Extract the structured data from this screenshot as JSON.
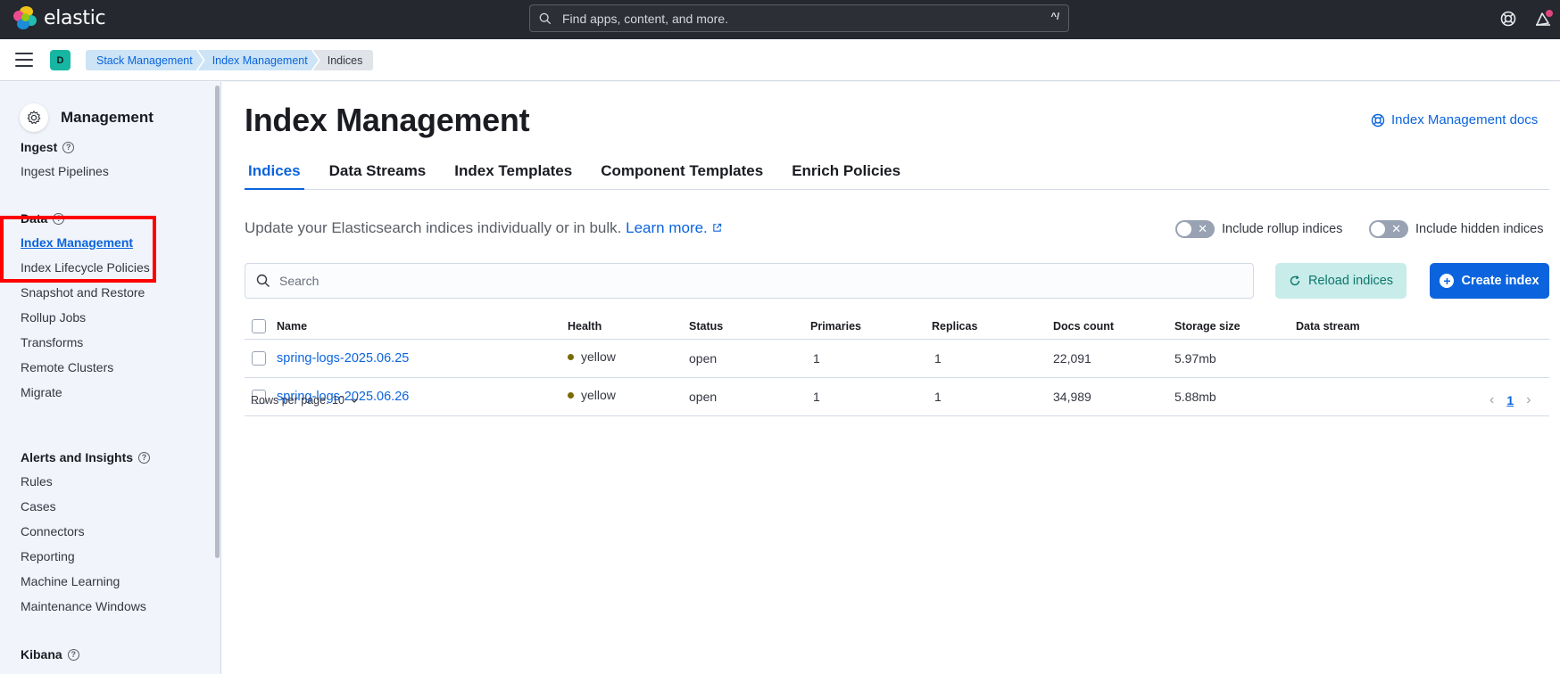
{
  "header": {
    "brand": "elastic",
    "search_placeholder": "Find apps, content, and more.",
    "search_shortcut": "^/"
  },
  "breadcrumbs": {
    "space_initial": "D",
    "items": [
      "Stack Management",
      "Index Management",
      "Indices"
    ]
  },
  "sidebar": {
    "title": "Management",
    "groups": [
      {
        "heading": "Ingest",
        "items": [
          "Ingest Pipelines"
        ]
      },
      {
        "heading": "Data",
        "items": [
          "Index Management",
          "Index Lifecycle Policies",
          "Snapshot and Restore",
          "Rollup Jobs",
          "Transforms",
          "Remote Clusters",
          "Migrate"
        ]
      },
      {
        "heading": "Alerts and Insights",
        "items": [
          "Rules",
          "Cases",
          "Connectors",
          "Reporting",
          "Machine Learning",
          "Maintenance Windows"
        ]
      },
      {
        "heading": "Kibana",
        "items": []
      }
    ],
    "active_item": "Index Management"
  },
  "main": {
    "title": "Index Management",
    "docs_link": "Index Management docs",
    "tabs": [
      "Indices",
      "Data Streams",
      "Index Templates",
      "Component Templates",
      "Enrich Policies"
    ],
    "active_tab": "Indices",
    "description": "Update your Elasticsearch indices individually or in bulk.",
    "learn_more": "Learn more.",
    "toggle_rollup": "Include rollup indices",
    "toggle_hidden": "Include hidden indices",
    "search_placeholder": "Search",
    "reload_button": "Reload indices",
    "create_button": "Create index",
    "table": {
      "columns": [
        "Name",
        "Health",
        "Status",
        "Primaries",
        "Replicas",
        "Docs count",
        "Storage size",
        "Data stream"
      ],
      "rows": [
        {
          "name": "spring-logs-2025.06.25",
          "health": "yellow",
          "status": "open",
          "primaries": "1",
          "replicas": "1",
          "docs_count": "22,091",
          "storage_size": "5.97mb",
          "data_stream": ""
        },
        {
          "name": "spring-logs-2025.06.26",
          "health": "yellow",
          "status": "open",
          "primaries": "1",
          "replicas": "1",
          "docs_count": "34,989",
          "storage_size": "5.88mb",
          "data_stream": ""
        }
      ]
    },
    "rows_per_page": "Rows per page: 10",
    "current_page": "1"
  },
  "colors": {
    "accent": "#0b64dd",
    "header_bg": "#25282f",
    "sidebar_bg": "#f1f4fa",
    "highlight": "#ff0000",
    "health_yellow": "#7a6a00"
  }
}
